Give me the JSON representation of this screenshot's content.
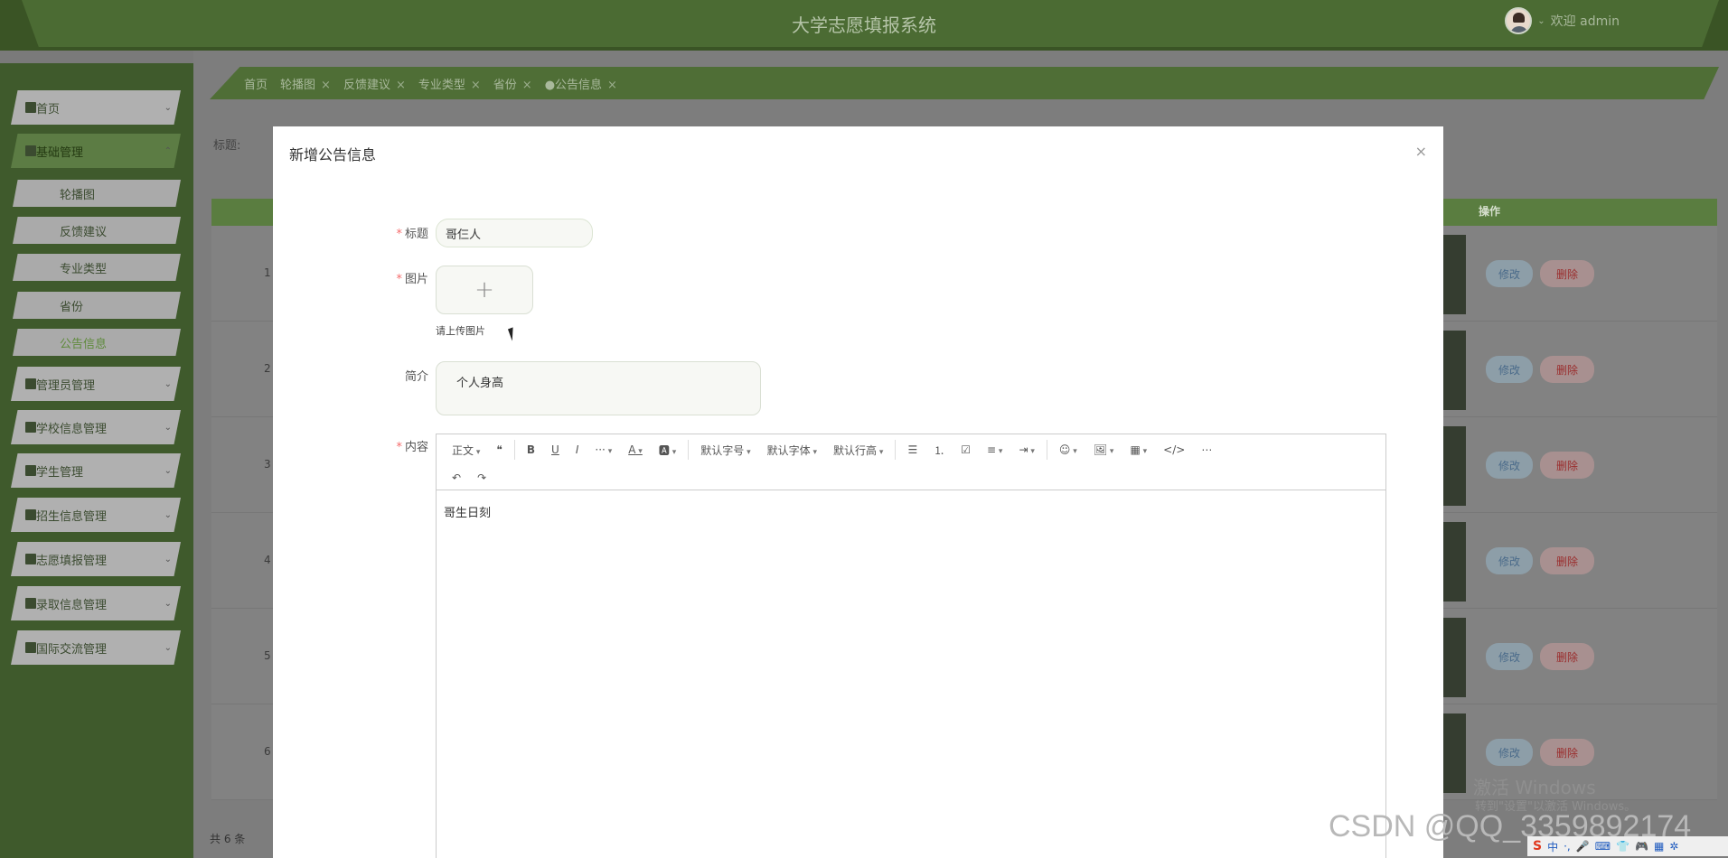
{
  "app": {
    "title": "大学志愿填报系统",
    "welcome": "欢迎 admin"
  },
  "sidebar": {
    "items": [
      {
        "label": "首页",
        "icon": "home-icon"
      },
      {
        "label": "基础管理",
        "icon": "grid-icon",
        "expanded": true
      },
      {
        "label": "管理员管理",
        "icon": "grid-icon"
      },
      {
        "label": "学校信息管理",
        "icon": "user-icon"
      },
      {
        "label": "学生管理",
        "icon": "student-icon"
      },
      {
        "label": "招生信息管理",
        "icon": "book-icon"
      },
      {
        "label": "志愿填报管理",
        "icon": "table-icon"
      },
      {
        "label": "录取信息管理",
        "icon": "gift-icon"
      },
      {
        "label": "国际交流管理",
        "icon": "grid-icon"
      }
    ],
    "sub_items": [
      "轮播图",
      "反馈建议",
      "专业类型",
      "省份",
      "公告信息"
    ]
  },
  "tabs": [
    "首页",
    "轮播图",
    "反馈建议",
    "专业类型",
    "省份",
    "●公告信息"
  ],
  "filter": {
    "label": "标题:"
  },
  "table": {
    "op_header": "操作",
    "rows": [
      {
        "num": "1",
        "edit": "修改",
        "del": "删除"
      },
      {
        "num": "2",
        "edit": "修改",
        "del": "删除"
      },
      {
        "num": "3",
        "edit": "修改",
        "del": "删除"
      },
      {
        "num": "4",
        "edit": "修改",
        "del": "删除"
      },
      {
        "num": "5",
        "edit": "修改",
        "del": "删除"
      },
      {
        "num": "6",
        "edit": "修改",
        "del": "删除"
      }
    ]
  },
  "pagination": {
    "total": "共 6 条"
  },
  "dialog": {
    "title": "新增公告信息",
    "close": "×",
    "fields": {
      "title_label": "标题",
      "title_value": "哥仨人",
      "image_label": "图片",
      "upload_plus": "+",
      "upload_tip": "请上传图片",
      "intro_label": "简介",
      "intro_value": "个人身高",
      "content_label": "内容",
      "content_value": "哥生日刻"
    },
    "toolbar": {
      "row1": [
        "正文",
        "❝",
        "B",
        "U",
        "I",
        "···",
        "A",
        "🅰",
        "默认字号",
        "默认字体",
        "默认行高",
        "☰",
        "⒈",
        "☑",
        "≡",
        "⇥",
        "☺",
        "🖼",
        "▦",
        "</>",
        "⋯"
      ],
      "row2": [
        "↶",
        "↷"
      ]
    }
  },
  "watermarks": {
    "windows_line1": "激活 Windows",
    "windows_line2": "转到\"设置\"以激活 Windows。",
    "csdn": "CSDN @QQ_3359892174"
  },
  "tray": {
    "ime": "中"
  },
  "colors": {
    "header": "#4b6b33",
    "sidebar": "#3f5a2c",
    "accent": "#5c7c44",
    "danger": "#f56c6c"
  }
}
